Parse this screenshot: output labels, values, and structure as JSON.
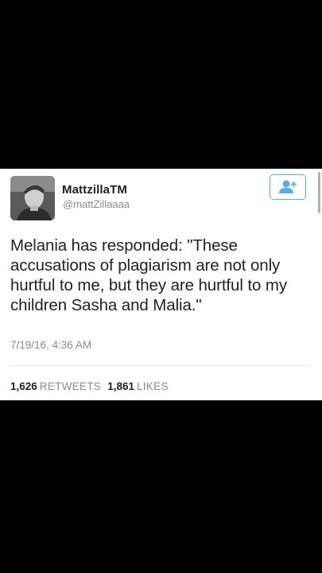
{
  "tweet": {
    "author": {
      "display_name": "MattzillaTM",
      "handle": "@mattZillaaaa",
      "avatar_icon": "profile-photo"
    },
    "follow_button_icon": "add-user-icon",
    "text": "Melania has responded: \"These accusations of plagiarism are not only hurtful to me, but they are hurtful to my children Sasha and Malia.\"",
    "timestamp": "7/19/16, 4:36 AM",
    "stats": {
      "retweets_count": "1,626",
      "retweets_label": "RETWEETS",
      "likes_count": "1,861",
      "likes_label": "LIKES"
    }
  },
  "colors": {
    "background": "#000000",
    "card": "#ffffff",
    "accent": "#55acee",
    "text_primary": "#222222",
    "text_secondary": "#8a8a8a"
  }
}
